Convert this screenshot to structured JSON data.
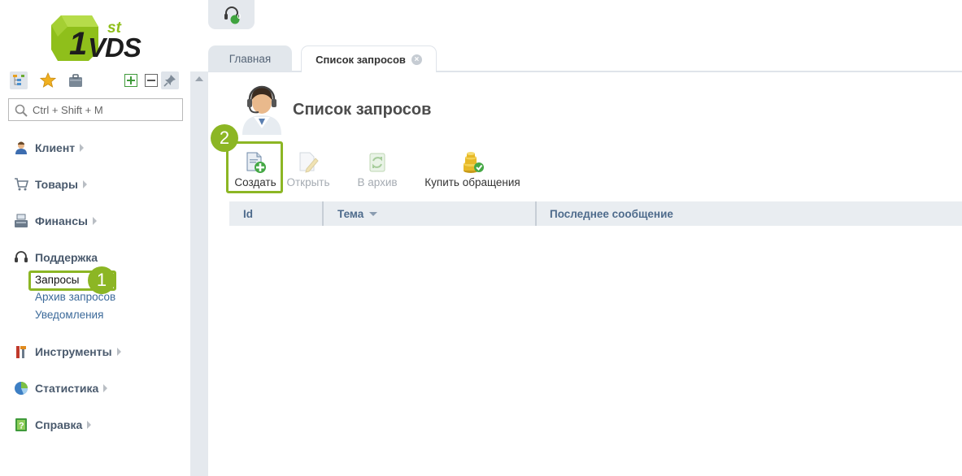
{
  "logo": {
    "superscript": "st",
    "brand": "VDS",
    "alt": "1stVDS"
  },
  "sidebar": {
    "toolbar_icons": [
      "tree-icon",
      "star-icon",
      "briefcase-icon",
      "expand-plus-icon",
      "collapse-minus-icon",
      "pin-icon"
    ],
    "search_placeholder": "Ctrl + Shift + M",
    "menu": [
      {
        "label": "Клиент",
        "icon": "client-icon"
      },
      {
        "label": "Товары",
        "icon": "cart-icon"
      },
      {
        "label": "Финансы",
        "icon": "cash-register-icon"
      },
      {
        "label": "Поддержка",
        "icon": "headset-icon",
        "expanded": true,
        "children": [
          {
            "label": "Запросы",
            "selected": true
          },
          {
            "label": "Архив запросов"
          },
          {
            "label": "Уведомления"
          }
        ]
      },
      {
        "label": "Инструменты",
        "icon": "tools-icon"
      },
      {
        "label": "Статистика",
        "icon": "pie-chart-icon"
      },
      {
        "label": "Справка",
        "icon": "help-book-icon"
      }
    ]
  },
  "header": {
    "support_button_icon": "headset-icon",
    "support_badge_count": "0"
  },
  "tabs": [
    {
      "label": "Главная",
      "active": false
    },
    {
      "label": "Список запросов",
      "active": true,
      "closable": true,
      "close_glyph": "×"
    }
  ],
  "page": {
    "title": "Список запросов",
    "avatar_icon": "support-operator-icon"
  },
  "toolbar": [
    {
      "label": "Создать",
      "icon": "create-doc-icon",
      "enabled": true
    },
    {
      "label": "Открыть",
      "icon": "edit-doc-icon",
      "enabled": false
    },
    {
      "label": "В архив",
      "icon": "archive-icon",
      "enabled": false
    },
    {
      "label": "Купить обращения",
      "icon": "coins-icon",
      "enabled": true
    }
  ],
  "table": {
    "columns": [
      {
        "label": "Id"
      },
      {
        "label": "Тема",
        "sorted": "desc"
      },
      {
        "label": "Последнее сообщение"
      }
    ],
    "rows": []
  },
  "annotations": {
    "step1": "1",
    "step2": "2"
  },
  "colors": {
    "accent_green": "#8cb624",
    "header_blue": "#4e6b8c",
    "link_blue": "#3c6a9a"
  }
}
